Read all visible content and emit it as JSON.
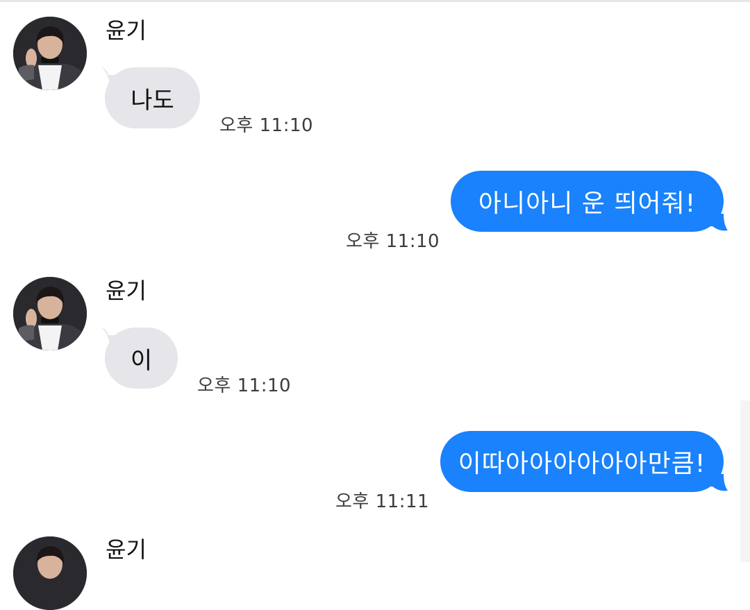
{
  "colors": {
    "incoming_bubble": "#e5e5ea",
    "outgoing_bubble": "#1982fc",
    "incoming_text": "#111111",
    "outgoing_text": "#ffffff",
    "timestamp": "#3c3c3c"
  },
  "messages": [
    {
      "sender": "윤기",
      "text": "나도",
      "time": "오후 11:10",
      "direction": "incoming"
    },
    {
      "text": "아니아니 운 띄어줘!",
      "time": "오후 11:10",
      "direction": "outgoing"
    },
    {
      "sender": "윤기",
      "text": "이",
      "time": "오후 11:10",
      "direction": "incoming"
    },
    {
      "text": "이따아아아아아아만큼!",
      "time": "오후 11:11",
      "direction": "outgoing"
    },
    {
      "sender": "윤기",
      "direction": "incoming"
    }
  ]
}
